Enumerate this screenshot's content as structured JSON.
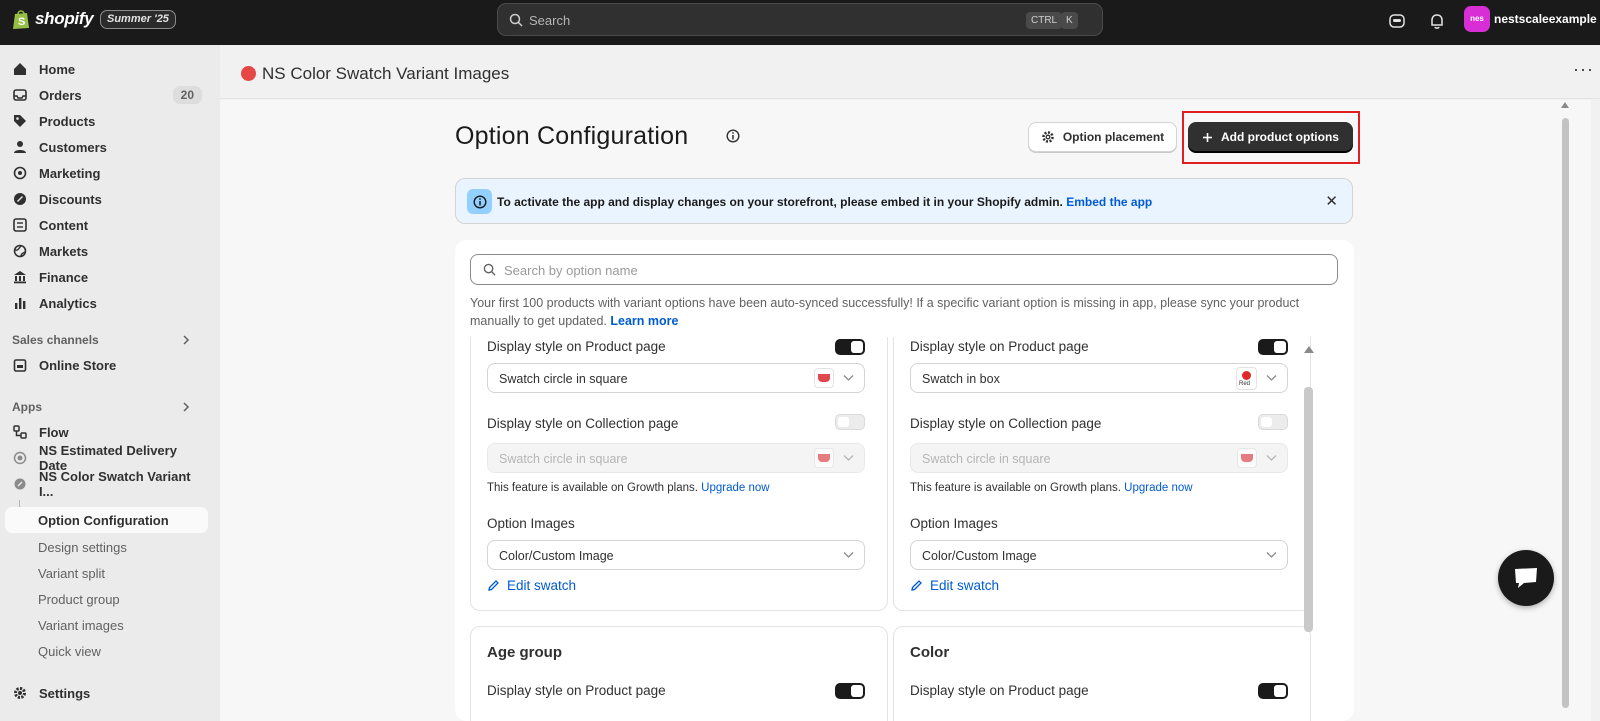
{
  "topbar": {
    "brand": "shopify",
    "edition_badge": "Summer '25",
    "search_placeholder": "Search",
    "shortcut_ctrl": "CTRL",
    "shortcut_k": "K",
    "user_initials": "nes",
    "user_name": "nestscaleexample"
  },
  "sidebar": {
    "items": [
      {
        "label": "Home",
        "icon": "home-icon"
      },
      {
        "label": "Orders",
        "icon": "inbox-icon",
        "count": "20"
      },
      {
        "label": "Products",
        "icon": "tag-icon"
      },
      {
        "label": "Customers",
        "icon": "person-icon"
      },
      {
        "label": "Marketing",
        "icon": "target-icon"
      },
      {
        "label": "Discounts",
        "icon": "discount-icon"
      },
      {
        "label": "Content",
        "icon": "content-icon"
      },
      {
        "label": "Markets",
        "icon": "globe-icon"
      },
      {
        "label": "Finance",
        "icon": "bank-icon"
      },
      {
        "label": "Analytics",
        "icon": "bar-chart-icon"
      }
    ],
    "sales_channels_label": "Sales channels",
    "online_store": "Online Store",
    "apps_label": "Apps",
    "apps": [
      {
        "label": "Flow"
      },
      {
        "label": "NS Estimated Delivery Date"
      },
      {
        "label": "NS Color Swatch Variant I..."
      }
    ],
    "sub_items": [
      "Option Configuration",
      "Design settings",
      "Variant split",
      "Product group",
      "Variant images",
      "Quick view"
    ],
    "settings": "Settings"
  },
  "app_header": {
    "title": "NS Color Swatch Variant Images"
  },
  "page": {
    "title": "Option Configuration",
    "option_placement_label": "Option placement",
    "add_options_label": "Add product options"
  },
  "banner": {
    "text": "To activate the app and display changes on your storefront, please embed it in your Shopify admin.",
    "link": "Embed the app"
  },
  "search": {
    "placeholder": "Search by option name"
  },
  "sync_note": {
    "text": "Your first 100 products with variant options have been auto-synced successfully! If a specific variant option is missing in app, please sync your product manually to get updated.",
    "link": "Learn more"
  },
  "option_cards": [
    {
      "product_page_label": "Display style on Product page",
      "product_style": "Swatch circle in square",
      "collection_page_label": "Display style on Collection page",
      "collection_style": "Swatch circle in square",
      "growth_note": "This feature is available on Growth plans.",
      "upgrade_link": "Upgrade now",
      "images_label": "Option Images",
      "images_value": "Color/Custom Image",
      "edit_label": "Edit swatch"
    },
    {
      "product_page_label": "Display style on Product page",
      "product_style": "Swatch in box",
      "swatch_text": "Red",
      "collection_page_label": "Display style on Collection page",
      "collection_style": "Swatch circle in square",
      "growth_note": "This feature is available on Growth plans.",
      "upgrade_link": "Upgrade now",
      "images_label": "Option Images",
      "images_value": "Color/Custom Image",
      "edit_label": "Edit swatch"
    }
  ],
  "next_cards": [
    {
      "title": "Age group",
      "product_page_label": "Display style on Product page"
    },
    {
      "title": "Color",
      "product_page_label": "Display style on Product page"
    }
  ],
  "colors": {
    "topbar": "#1a1a1a",
    "primary_button": "#303030",
    "link": "#005bd3",
    "highlight": "#e02020",
    "avatar": "#d72ed6"
  }
}
